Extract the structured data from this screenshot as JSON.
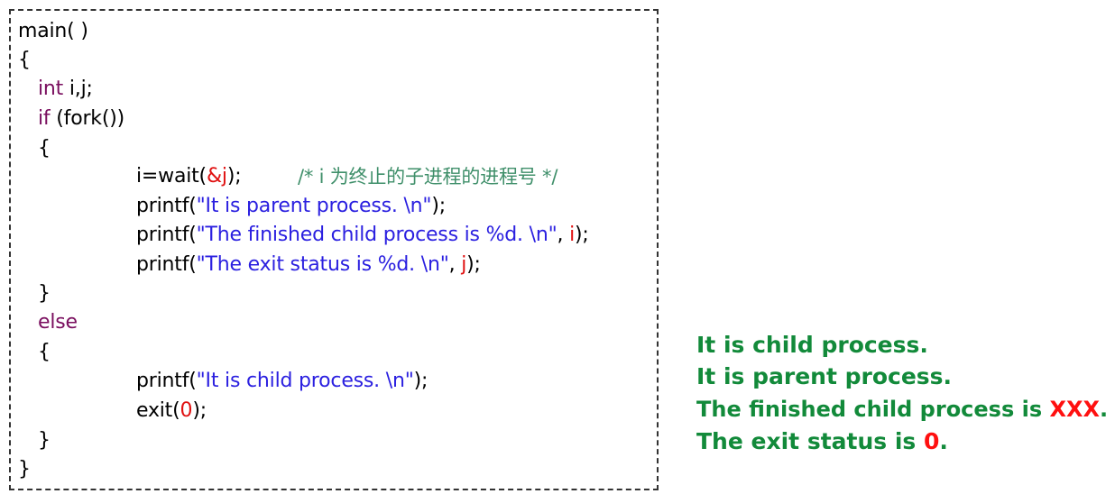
{
  "code": {
    "l1": "main( )",
    "l2": "{",
    "l3_kw": "int",
    "l3_rest": " i,j;",
    "l4_kw": "if",
    "l4_rest": " (fork())",
    "l5": "{",
    "l6_a": "i=wait(",
    "l6_amp": "&j",
    "l6_b": ");",
    "l6_comment": "/* i 为终止的子进程的进程号 */",
    "l7_a": "printf(",
    "l7_str": "\"It is parent process. \\n\"",
    "l7_b": ");",
    "l8_a": "printf(",
    "l8_str": "\"The finished child process is %d. \\n\"",
    "l8_c": ", ",
    "l8_var": "i",
    "l8_b": ");",
    "l9_a": "printf(",
    "l9_str": "\"The exit status is %d. \\n\"",
    "l9_c": ", ",
    "l9_var": "j",
    "l9_b": ");",
    "l10": "}",
    "l11_kw": "else",
    "l12": "{",
    "l13_a": "printf(",
    "l13_str": "\"It is child process. \\n\"",
    "l13_b": ");",
    "l14_a": "exit(",
    "l14_num": "0",
    "l14_b": ");",
    "l15": "}",
    "l16": "}"
  },
  "output": {
    "line1": "It is child process.",
    "line2": "It is parent process.",
    "line3_text": "The finished child process is ",
    "line3_value": "XXX",
    "line3_end": ".",
    "line4_text": "The exit status is ",
    "line4_value": "0",
    "line4_end": "."
  },
  "colors": {
    "keyword": "#7a0f5f",
    "string": "#2b20e0",
    "highlight": "#e01010",
    "comment": "#3f8f6a",
    "output": "#128a3a"
  }
}
